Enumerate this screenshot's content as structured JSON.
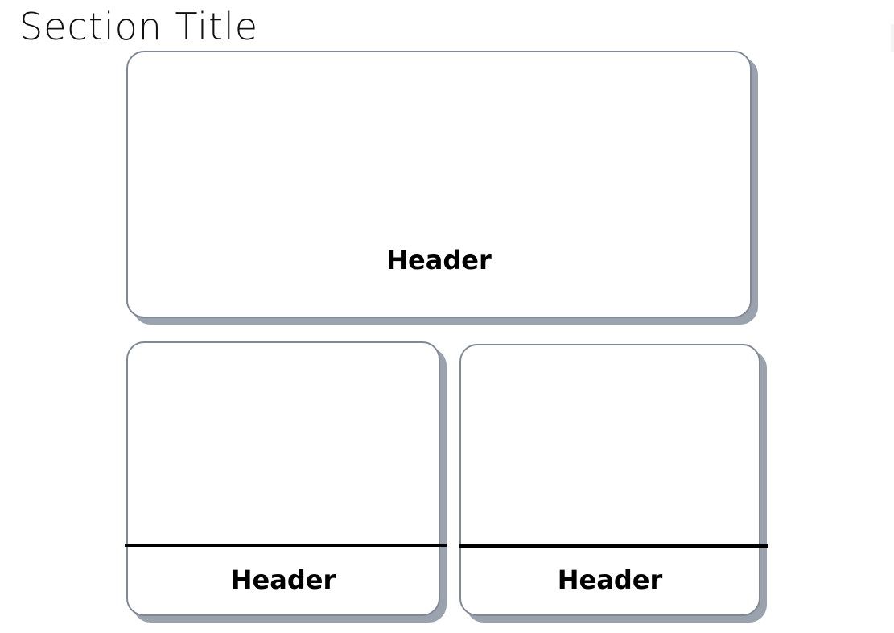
{
  "section": {
    "title": "Section Title"
  },
  "cards": {
    "top": {
      "header": "Header"
    },
    "bottom_left": {
      "header": "Header"
    },
    "bottom_right": {
      "header": "Header"
    }
  },
  "colors": {
    "card_border": "#7f8894",
    "card_shadow": "#9aa3ad",
    "divider": "#000000",
    "text": "#000000"
  }
}
